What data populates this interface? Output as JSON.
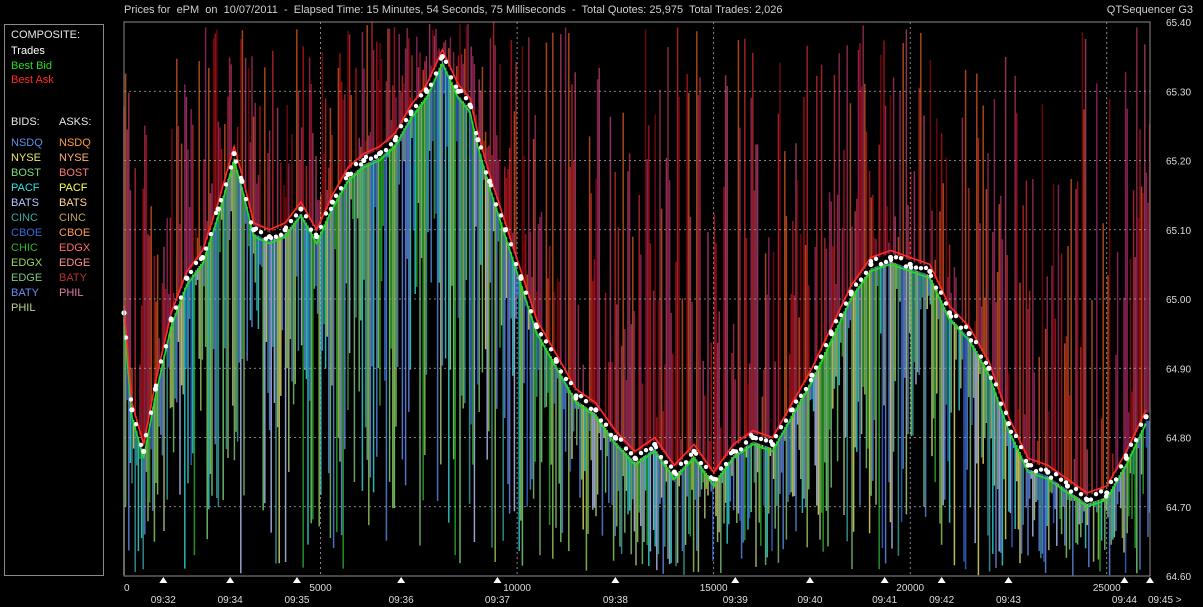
{
  "header": {
    "title": "Prices for  ePM  on  10/07/2011  -  Elapsed Time: 15 Minutes, 54 Seconds, 75 Milliseconds  -  Total Quotes: 25,975  Total Trades: 2,026",
    "app_name": "QTSequencer G3"
  },
  "legend": {
    "composite_heading": "COMPOSITE:",
    "composite": [
      {
        "label": "Trades",
        "color": "#ffffff"
      },
      {
        "label": "Best Bid",
        "color": "#22dd22"
      },
      {
        "label": "Best Ask",
        "color": "#ff2a2a"
      }
    ],
    "bids_heading": "BIDS:",
    "asks_heading": "ASKS:",
    "bids": [
      {
        "label": "NSDQ",
        "color": "#5a8fe6"
      },
      {
        "label": "NYSE",
        "color": "#e8e86a"
      },
      {
        "label": "BOST",
        "color": "#7ae07a"
      },
      {
        "label": "PACF",
        "color": "#33e0e0"
      },
      {
        "label": "BATS",
        "color": "#b8c8ff"
      },
      {
        "label": "CINC",
        "color": "#3aa7a7"
      },
      {
        "label": "CBOE",
        "color": "#3a6ad8"
      },
      {
        "label": "CHIC",
        "color": "#2ab42a"
      },
      {
        "label": "EDGX",
        "color": "#9ad65a"
      },
      {
        "label": "EDGE",
        "color": "#7ec87e"
      },
      {
        "label": "BATY",
        "color": "#6a8ff0"
      },
      {
        "label": "PHIL",
        "color": "#b6d68a"
      }
    ],
    "asks": [
      {
        "label": "NSDQ",
        "color": "#ff9a3a"
      },
      {
        "label": "NYSE",
        "color": "#ffb070"
      },
      {
        "label": "BOST",
        "color": "#ff7a7a"
      },
      {
        "label": "PACF",
        "color": "#ffff55"
      },
      {
        "label": "BATS",
        "color": "#ffd890"
      },
      {
        "label": "CINC",
        "color": "#c8a060"
      },
      {
        "label": "CBOE",
        "color": "#ff9a55"
      },
      {
        "label": "EDGX",
        "color": "#ff6a6a"
      },
      {
        "label": "EDGE",
        "color": "#ff8f8f"
      },
      {
        "label": "BATY",
        "color": "#b83030"
      },
      {
        "label": "PHIL",
        "color": "#e07aa8"
      }
    ]
  },
  "chart_data": {
    "type": "line",
    "title": "Prices for  ePM  on  10/07/2011",
    "y_ticks": [
      "65.40",
      "65.30",
      "65.20",
      "65.10",
      "65.00",
      "64.90",
      "64.80",
      "64.70",
      "64.60"
    ],
    "ylim": [
      64.6,
      65.4
    ],
    "xlim": [
      0,
      26100
    ],
    "x_count_ticks": [
      {
        "x": 0,
        "label": "0"
      },
      {
        "x": 5000,
        "label": "5000"
      },
      {
        "x": 10000,
        "label": "10000"
      },
      {
        "x": 15000,
        "label": "15000"
      },
      {
        "x": 20000,
        "label": "20000"
      },
      {
        "x": 25000,
        "label": "25000"
      }
    ],
    "x_time_ticks": [
      {
        "x": 1000,
        "label": "09:32"
      },
      {
        "x": 2700,
        "label": "09:34"
      },
      {
        "x": 4400,
        "label": "09:35"
      },
      {
        "x": 7050,
        "label": "09:36"
      },
      {
        "x": 9500,
        "label": "09:37"
      },
      {
        "x": 12500,
        "label": "09:38"
      },
      {
        "x": 15550,
        "label": "09:39"
      },
      {
        "x": 17450,
        "label": "09:40"
      },
      {
        "x": 19350,
        "label": "09:41"
      },
      {
        "x": 20800,
        "label": "09:42"
      },
      {
        "x": 22500,
        "label": "09:43"
      },
      {
        "x": 25450,
        "label": "09:44"
      },
      {
        "x": 26100,
        "label": "09:45 >"
      }
    ],
    "grid": true,
    "series": [
      {
        "name": "Trades",
        "color": "#ffffff",
        "x": [
          0,
          200,
          500,
          800,
          1200,
          1600,
          2000,
          2400,
          2800,
          3000,
          3300,
          3700,
          4100,
          4500,
          4900,
          5300,
          5700,
          6100,
          6500,
          6900,
          7300,
          7700,
          8100,
          8500,
          8800,
          9000,
          9300,
          9700,
          10100,
          10500,
          11000,
          11500,
          12000,
          12500,
          13000,
          13500,
          14000,
          14500,
          15000,
          15500,
          16000,
          16500,
          17000,
          17500,
          18000,
          18500,
          19000,
          19500,
          20000,
          20500,
          21000,
          21500,
          22000,
          22500,
          23000,
          23500,
          24000,
          24500,
          25000,
          25500,
          26000
        ],
        "y": [
          64.98,
          64.84,
          64.78,
          64.87,
          64.97,
          65.03,
          65.06,
          65.13,
          65.21,
          65.17,
          65.1,
          65.09,
          65.1,
          65.13,
          65.09,
          65.14,
          65.18,
          65.2,
          65.21,
          65.23,
          65.27,
          65.3,
          65.35,
          65.3,
          65.28,
          65.23,
          65.17,
          65.1,
          65.03,
          64.96,
          64.91,
          64.86,
          64.84,
          64.8,
          64.77,
          64.79,
          64.75,
          64.78,
          64.74,
          64.78,
          64.8,
          64.79,
          64.84,
          64.89,
          64.95,
          65.01,
          65.05,
          65.06,
          65.05,
          65.04,
          64.98,
          64.95,
          64.9,
          64.82,
          64.76,
          64.75,
          64.73,
          64.71,
          64.72,
          64.77,
          64.83
        ]
      },
      {
        "name": "Best Bid",
        "color": "#22dd22",
        "x": [
          0,
          200,
          500,
          800,
          1200,
          1600,
          2000,
          2400,
          2800,
          3000,
          3300,
          3700,
          4100,
          4500,
          4900,
          5300,
          5700,
          6100,
          6500,
          6900,
          7300,
          7700,
          8100,
          8500,
          8800,
          9000,
          9300,
          9700,
          10100,
          10500,
          11000,
          11500,
          12000,
          12500,
          13000,
          13500,
          14000,
          14500,
          15000,
          15500,
          16000,
          16500,
          17000,
          17500,
          18000,
          18500,
          19000,
          19500,
          20000,
          20500,
          21000,
          21500,
          22000,
          22500,
          23000,
          23500,
          24000,
          24500,
          25000,
          25500,
          26000
        ],
        "y": [
          64.97,
          64.83,
          64.77,
          64.86,
          64.96,
          65.02,
          65.05,
          65.12,
          65.2,
          65.16,
          65.09,
          65.08,
          65.09,
          65.12,
          65.08,
          65.13,
          65.17,
          65.19,
          65.2,
          65.22,
          65.26,
          65.29,
          65.34,
          65.29,
          65.27,
          65.22,
          65.16,
          65.09,
          65.02,
          64.95,
          64.9,
          64.85,
          64.83,
          64.79,
          64.76,
          64.78,
          64.74,
          64.77,
          64.73,
          64.77,
          64.79,
          64.78,
          64.83,
          64.88,
          64.94,
          65.0,
          65.04,
          65.05,
          65.04,
          65.03,
          64.97,
          64.94,
          64.89,
          64.81,
          64.75,
          64.74,
          64.72,
          64.7,
          64.71,
          64.76,
          64.82
        ]
      },
      {
        "name": "Best Ask",
        "color": "#ff2a2a",
        "x": [
          0,
          200,
          500,
          800,
          1200,
          1600,
          2000,
          2400,
          2800,
          3000,
          3300,
          3700,
          4100,
          4500,
          4900,
          5300,
          5700,
          6100,
          6500,
          6900,
          7300,
          7700,
          8100,
          8500,
          8800,
          9000,
          9300,
          9700,
          10100,
          10500,
          11000,
          11500,
          12000,
          12500,
          13000,
          13500,
          14000,
          14500,
          15000,
          15500,
          16000,
          16500,
          17000,
          17500,
          18000,
          18500,
          19000,
          19500,
          20000,
          20500,
          21000,
          21500,
          22000,
          22500,
          23000,
          23500,
          24000,
          24500,
          25000,
          25500,
          26000
        ],
        "y": [
          64.99,
          64.85,
          64.79,
          64.88,
          64.98,
          65.04,
          65.07,
          65.14,
          65.22,
          65.18,
          65.11,
          65.1,
          65.11,
          65.14,
          65.1,
          65.15,
          65.19,
          65.21,
          65.22,
          65.24,
          65.28,
          65.31,
          65.36,
          65.31,
          65.29,
          65.24,
          65.18,
          65.11,
          65.04,
          64.97,
          64.92,
          64.87,
          64.85,
          64.81,
          64.78,
          64.8,
          64.76,
          64.79,
          64.75,
          64.79,
          64.81,
          64.8,
          64.85,
          64.9,
          64.96,
          65.02,
          65.06,
          65.07,
          65.06,
          65.05,
          64.99,
          64.96,
          64.91,
          64.83,
          64.77,
          64.76,
          64.74,
          64.72,
          64.73,
          64.78,
          64.84
        ]
      }
    ]
  }
}
